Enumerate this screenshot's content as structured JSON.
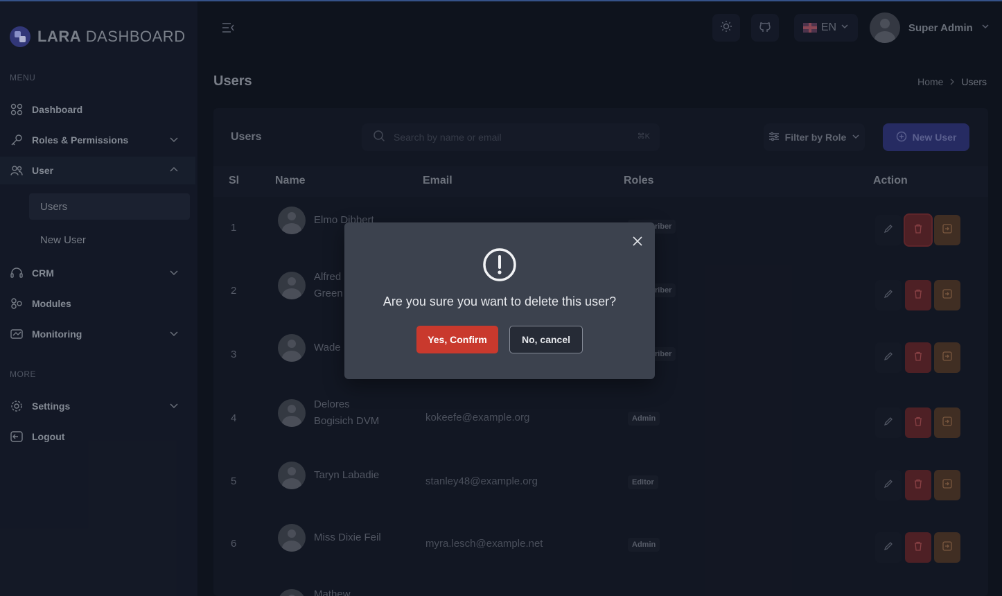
{
  "app": {
    "logo_bold": "LARA",
    "logo_rest": " DASHBOARD"
  },
  "sidebar": {
    "menu_heading": "MENU",
    "more_heading": "MORE",
    "items": [
      {
        "label": "Dashboard",
        "icon": "grid-icon"
      },
      {
        "label": "Roles & Permissions",
        "icon": "key-icon"
      },
      {
        "label": "User",
        "icon": "users-icon"
      },
      {
        "label": "CRM",
        "icon": "headset-icon"
      },
      {
        "label": "Modules",
        "icon": "modules-icon"
      },
      {
        "label": "Monitoring",
        "icon": "monitor-icon"
      },
      {
        "label": "Settings",
        "icon": "gear-icon"
      },
      {
        "label": "Logout",
        "icon": "logout-icon"
      }
    ],
    "user_sub": [
      "Users",
      "New User"
    ]
  },
  "header": {
    "language": "EN",
    "user_name": "Super Admin"
  },
  "page": {
    "title": "Users",
    "breadcrumb_home": "Home",
    "breadcrumb_current": "Users"
  },
  "card": {
    "title": "Users",
    "search_placeholder": "Search by name or email",
    "search_shortcut": "⌘K",
    "filter_label": "Filter by Role",
    "new_user_label": "New User"
  },
  "table": {
    "headers": [
      "Sl",
      "Name",
      "Email",
      "Roles",
      "Action"
    ],
    "rows": [
      {
        "sl": "1",
        "name": "Elmo Dibbert",
        "email": "",
        "role": "Subscriber"
      },
      {
        "sl": "2",
        "name": "Alfred Green",
        "email": "",
        "role": "Subscriber"
      },
      {
        "sl": "3",
        "name": "Wade",
        "email": "",
        "role": "Subscriber"
      },
      {
        "sl": "4",
        "name": "Delores Bogisich DVM",
        "email": "kokeefe@example.org",
        "role": "Admin"
      },
      {
        "sl": "5",
        "name": "Taryn Labadie",
        "email": "stanley48@example.org",
        "role": "Editor"
      },
      {
        "sl": "6",
        "name": "Miss Dixie Feil",
        "email": "myra.lesch@example.net",
        "role": "Admin"
      },
      {
        "sl": "",
        "name": "Mathew",
        "email": "",
        "role": ""
      }
    ]
  },
  "modal": {
    "message": "Are you sure you want to delete this user?",
    "confirm_label": "Yes, Confirm",
    "cancel_label": "No, cancel"
  },
  "colors": {
    "confirm": "#c9392d",
    "accent": "#2c3170",
    "delete": "#5b2428",
    "login": "#4a3426"
  }
}
